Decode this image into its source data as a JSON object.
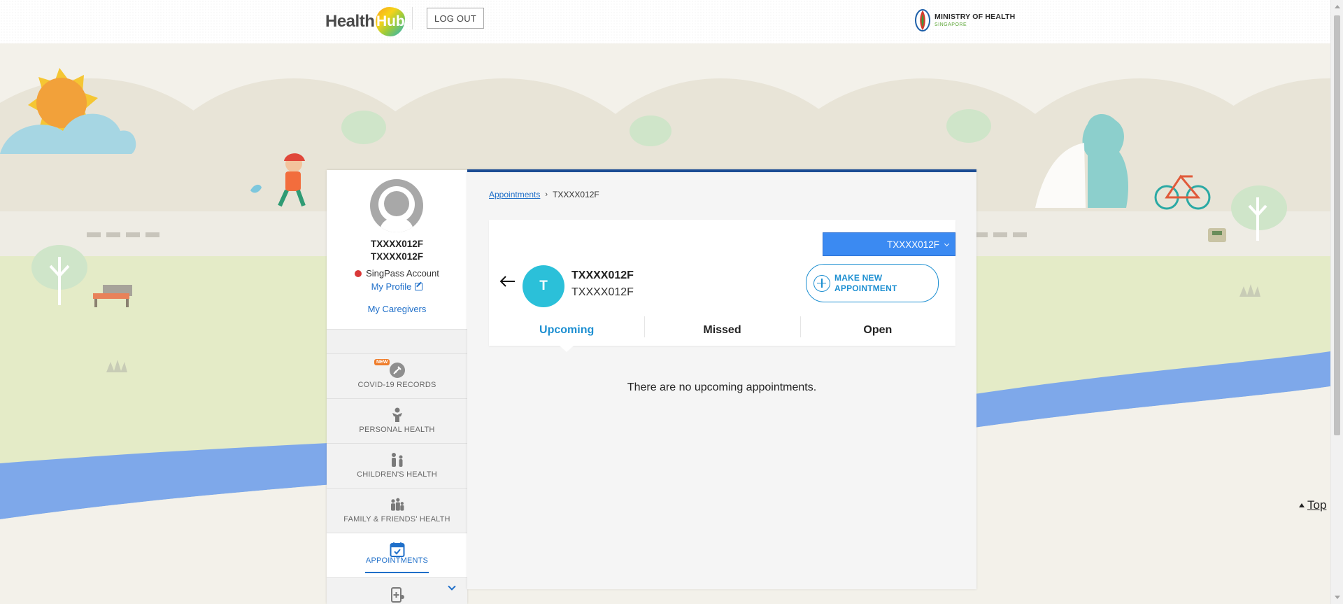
{
  "header": {
    "logo_health": "Health",
    "logo_hub": "Hub",
    "logout_label": "LOG OUT",
    "moh_title": "MINISTRY OF HEALTH",
    "moh_subtitle": "SINGAPORE"
  },
  "sidebar": {
    "name_line1": "TXXXX012F",
    "name_line2": "TXXXX012F",
    "account_status": "SingPass Account",
    "status_color": "#d93838",
    "my_profile": "My Profile",
    "my_caregivers": "My Caregivers",
    "nav": [
      {
        "label": "COVID-19 RECORDS",
        "icon": "syringe-icon",
        "badge": "NEW",
        "active": false
      },
      {
        "label": "PERSONAL HEALTH",
        "icon": "person-health-icon",
        "active": false
      },
      {
        "label": "CHILDREN'S HEALTH",
        "icon": "children-icon",
        "active": false
      },
      {
        "label": "FAMILY & FRIENDS' HEALTH",
        "icon": "family-icon",
        "active": false
      },
      {
        "label": "APPOINTMENTS",
        "icon": "calendar-check-icon",
        "active": true
      },
      {
        "label": "",
        "icon": "medication-icon",
        "active": false
      }
    ]
  },
  "main": {
    "breadcrumb": {
      "link": "Appointments",
      "current": "TXXXX012F"
    },
    "member_select": {
      "selected": "TXXXX012F"
    },
    "member": {
      "initial": "T",
      "name": "TXXXX012F",
      "id": "TXXXX012F"
    },
    "make_appointment": {
      "line1": "MAKE NEW",
      "line2": "APPOINTMENT"
    },
    "tabs": [
      {
        "label": "Upcoming",
        "active": true
      },
      {
        "label": "Missed",
        "active": false
      },
      {
        "label": "Open",
        "active": false
      }
    ],
    "empty_message": "There are no upcoming appointments."
  },
  "top_link": "Top",
  "colors": {
    "accent_blue": "#1f6fc9",
    "navy_border": "#1c4c94",
    "select_blue": "#3b8af2",
    "avatar_teal": "#2bc0d9"
  }
}
